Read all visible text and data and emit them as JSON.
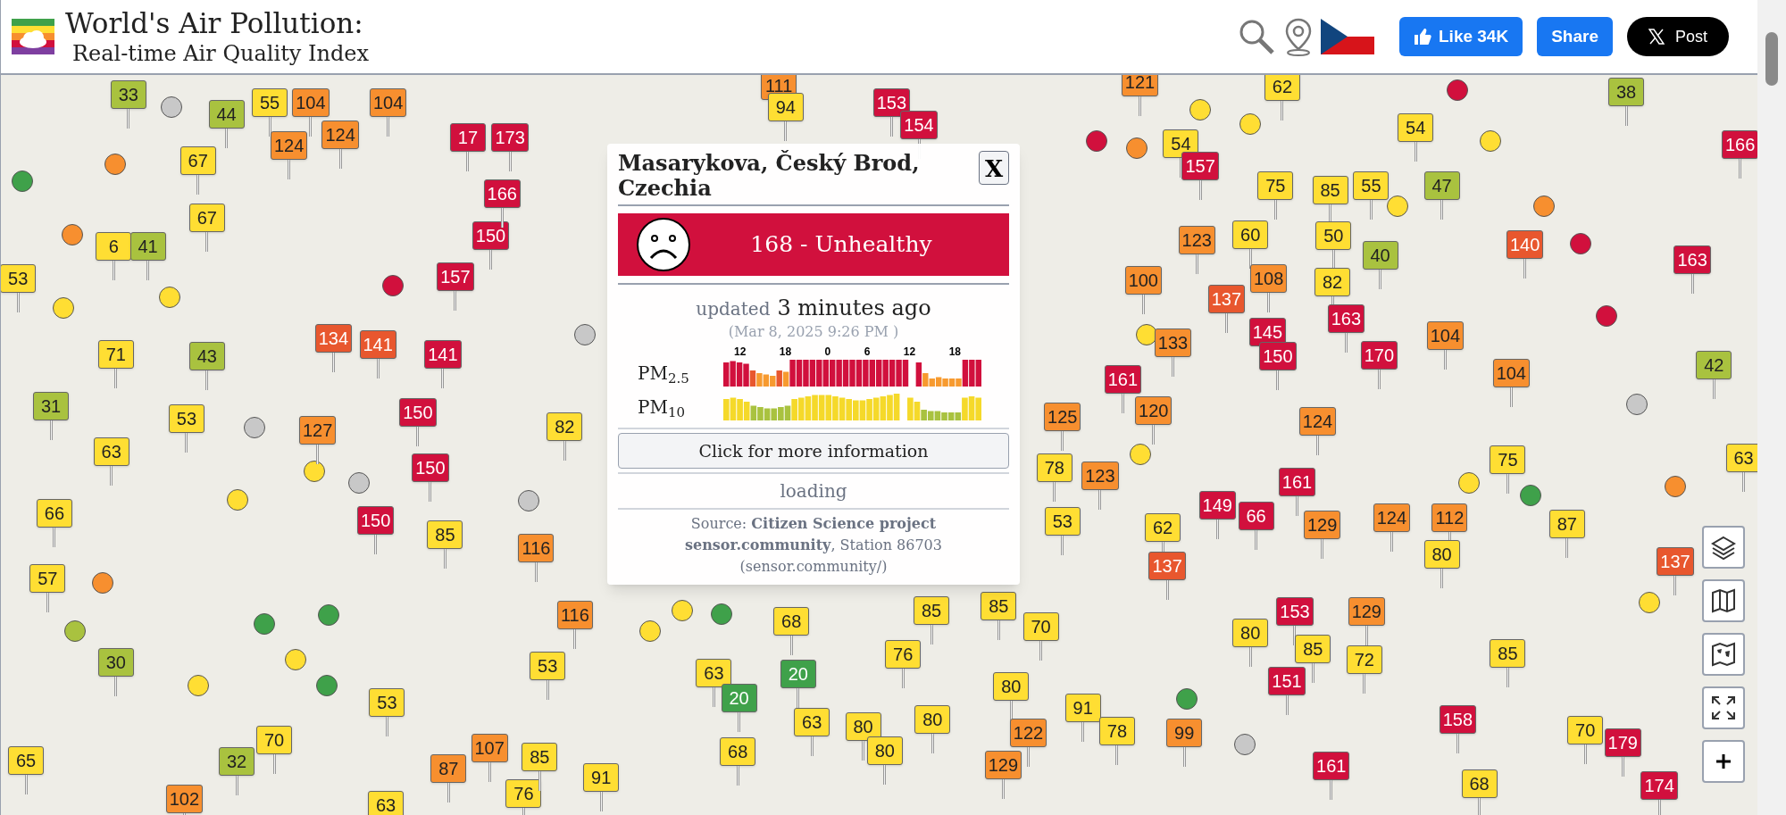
{
  "header": {
    "title": "World's Air Pollution:",
    "subtitle": "Real-time Air Quality Index",
    "like_button": "Like 34K",
    "share_button": "Share",
    "post_button": "Post"
  },
  "map": {
    "markers": [
      {
        "value": "33",
        "color": "#a9c23f"
      },
      {
        "value": "44",
        "color": "#a9c23f"
      },
      {
        "value": "55",
        "color": "#ffde33"
      },
      {
        "value": "104",
        "color": "#f78f2f"
      },
      {
        "value": "104",
        "color": "#f78f2f"
      },
      {
        "value": "111",
        "color": "#f78f2f"
      },
      {
        "value": "94",
        "color": "#ffde33"
      },
      {
        "value": "153",
        "color": "#d1103d"
      },
      {
        "value": "121",
        "color": "#f78f2f"
      },
      {
        "value": "62",
        "color": "#ffde33"
      },
      {
        "value": "38",
        "color": "#a9c23f"
      },
      {
        "value": "67",
        "color": "#ffde33"
      },
      {
        "value": "124",
        "color": "#f78f2f"
      },
      {
        "value": "124",
        "color": "#f78f2f"
      },
      {
        "value": "17",
        "color": "#d1103d"
      },
      {
        "value": "173",
        "color": "#d1103d"
      },
      {
        "value": "154",
        "color": "#d1103d"
      },
      {
        "value": "54",
        "color": "#ffde33"
      },
      {
        "value": "157",
        "color": "#d1103d"
      },
      {
        "value": "54",
        "color": "#ffde33"
      },
      {
        "value": "166",
        "color": "#d1103d"
      },
      {
        "value": "67",
        "color": "#ffde33"
      },
      {
        "value": "150",
        "color": "#d1103d"
      },
      {
        "value": "166",
        "color": "#d1103d"
      },
      {
        "value": "60",
        "color": "#ffde33"
      },
      {
        "value": "75",
        "color": "#ffde33"
      },
      {
        "value": "85",
        "color": "#ffde33"
      },
      {
        "value": "50",
        "color": "#ffde33"
      },
      {
        "value": "55",
        "color": "#ffde33"
      },
      {
        "value": "47",
        "color": "#a9c23f"
      },
      {
        "value": "53",
        "color": "#ffde33"
      },
      {
        "value": "6",
        "color": "#ffde33"
      },
      {
        "value": "41",
        "color": "#a9c23f"
      },
      {
        "value": "157",
        "color": "#d1103d"
      },
      {
        "value": "100",
        "color": "#f78f2f"
      },
      {
        "value": "123",
        "color": "#f78f2f"
      },
      {
        "value": "108",
        "color": "#f78f2f"
      },
      {
        "value": "82",
        "color": "#ffde33"
      },
      {
        "value": "40",
        "color": "#a9c23f"
      },
      {
        "value": "140",
        "color": "#e8572e"
      },
      {
        "value": "163",
        "color": "#d1103d"
      },
      {
        "value": "134",
        "color": "#e8572e"
      },
      {
        "value": "141",
        "color": "#e8572e"
      },
      {
        "value": "133",
        "color": "#f78f2f"
      },
      {
        "value": "137",
        "color": "#e8572e"
      },
      {
        "value": "145",
        "color": "#d1103d"
      },
      {
        "value": "163",
        "color": "#d1103d"
      },
      {
        "value": "104",
        "color": "#f78f2f"
      },
      {
        "value": "31",
        "color": "#a9c23f"
      },
      {
        "value": "71",
        "color": "#ffde33"
      },
      {
        "value": "43",
        "color": "#a9c23f"
      },
      {
        "value": "141",
        "color": "#d1103d"
      },
      {
        "value": "161",
        "color": "#d1103d"
      },
      {
        "value": "150",
        "color": "#d1103d"
      },
      {
        "value": "170",
        "color": "#d1103d"
      },
      {
        "value": "104",
        "color": "#f78f2f"
      },
      {
        "value": "42",
        "color": "#a9c23f"
      },
      {
        "value": "63",
        "color": "#ffde33"
      },
      {
        "value": "53",
        "color": "#ffde33"
      },
      {
        "value": "127",
        "color": "#f78f2f"
      },
      {
        "value": "150",
        "color": "#d1103d"
      },
      {
        "value": "82",
        "color": "#ffde33"
      },
      {
        "value": "125",
        "color": "#f78f2f"
      },
      {
        "value": "120",
        "color": "#f78f2f"
      },
      {
        "value": "124",
        "color": "#f78f2f"
      },
      {
        "value": "75",
        "color": "#ffde33"
      },
      {
        "value": "63",
        "color": "#ffde33"
      },
      {
        "value": "66",
        "color": "#ffde33"
      },
      {
        "value": "150",
        "color": "#d1103d"
      },
      {
        "value": "150",
        "color": "#d1103d"
      },
      {
        "value": "78",
        "color": "#ffde33"
      },
      {
        "value": "53",
        "color": "#ffde33"
      },
      {
        "value": "123",
        "color": "#f78f2f"
      },
      {
        "value": "149",
        "color": "#d1103d"
      },
      {
        "value": "66",
        "color": "#d1103d"
      },
      {
        "value": "161",
        "color": "#d1103d"
      },
      {
        "value": "124",
        "color": "#f78f2f"
      },
      {
        "value": "112",
        "color": "#f78f2f"
      },
      {
        "value": "57",
        "color": "#ffde33"
      },
      {
        "value": "85",
        "color": "#ffde33"
      },
      {
        "value": "116",
        "color": "#f78f2f"
      },
      {
        "value": "62",
        "color": "#ffde33"
      },
      {
        "value": "137",
        "color": "#e8572e"
      },
      {
        "value": "129",
        "color": "#f78f2f"
      },
      {
        "value": "80",
        "color": "#ffde33"
      },
      {
        "value": "87",
        "color": "#ffde33"
      },
      {
        "value": "137",
        "color": "#e8572e"
      },
      {
        "value": "116",
        "color": "#f78f2f"
      },
      {
        "value": "68",
        "color": "#ffde33"
      },
      {
        "value": "85",
        "color": "#ffde33"
      },
      {
        "value": "85",
        "color": "#ffde33"
      },
      {
        "value": "70",
        "color": "#ffde33"
      },
      {
        "value": "80",
        "color": "#ffde33"
      },
      {
        "value": "153",
        "color": "#d1103d"
      },
      {
        "value": "129",
        "color": "#f78f2f"
      },
      {
        "value": "30",
        "color": "#a9c23f"
      },
      {
        "value": "53",
        "color": "#ffde33"
      },
      {
        "value": "63",
        "color": "#ffde33"
      },
      {
        "value": "20",
        "color": "#3fa14a"
      },
      {
        "value": "76",
        "color": "#ffde33"
      },
      {
        "value": "80",
        "color": "#ffde33"
      },
      {
        "value": "151",
        "color": "#d1103d"
      },
      {
        "value": "85",
        "color": "#ffde33"
      },
      {
        "value": "72",
        "color": "#ffde33"
      },
      {
        "value": "85",
        "color": "#ffde33"
      },
      {
        "value": "65",
        "color": "#ffde33"
      },
      {
        "value": "70",
        "color": "#ffde33"
      },
      {
        "value": "53",
        "color": "#ffde33"
      },
      {
        "value": "107",
        "color": "#f78f2f"
      },
      {
        "value": "20",
        "color": "#3fa14a"
      },
      {
        "value": "63",
        "color": "#ffde33"
      },
      {
        "value": "80",
        "color": "#ffde33"
      },
      {
        "value": "80",
        "color": "#ffde33"
      },
      {
        "value": "122",
        "color": "#f78f2f"
      },
      {
        "value": "91",
        "color": "#ffde33"
      },
      {
        "value": "78",
        "color": "#ffde33"
      },
      {
        "value": "99",
        "color": "#f78f2f"
      },
      {
        "value": "158",
        "color": "#d1103d"
      },
      {
        "value": "70",
        "color": "#ffde33"
      },
      {
        "value": "179",
        "color": "#d1103d"
      },
      {
        "value": "102",
        "color": "#f78f2f"
      },
      {
        "value": "32",
        "color": "#a9c23f"
      },
      {
        "value": "63",
        "color": "#ffde33"
      },
      {
        "value": "87",
        "color": "#f78f2f"
      },
      {
        "value": "76",
        "color": "#ffde33"
      },
      {
        "value": "85",
        "color": "#ffde33"
      },
      {
        "value": "91",
        "color": "#ffde33"
      },
      {
        "value": "68",
        "color": "#ffde33"
      },
      {
        "value": "80",
        "color": "#ffde33"
      },
      {
        "value": "129",
        "color": "#f78f2f"
      },
      {
        "value": "161",
        "color": "#d1103d"
      },
      {
        "value": "68",
        "color": "#ffde33"
      },
      {
        "value": "174",
        "color": "#d1103d"
      }
    ],
    "dots": [
      {
        "color": "#3fa14a"
      },
      {
        "color": "#f78f2f"
      },
      {
        "color": "#f78f2f"
      },
      {
        "color": "#c8c8c8"
      },
      {
        "color": "#ffde33"
      },
      {
        "color": "#ffde33"
      },
      {
        "color": "#d1103d"
      },
      {
        "color": "#c8c8c8"
      },
      {
        "color": "#c8c8c8"
      },
      {
        "color": "#ffde33"
      },
      {
        "color": "#ffde33"
      },
      {
        "color": "#c8c8c8"
      },
      {
        "color": "#c8c8c8"
      },
      {
        "color": "#f78f2f"
      },
      {
        "color": "#a9c23f"
      },
      {
        "color": "#3fa14a"
      },
      {
        "color": "#3fa14a"
      },
      {
        "color": "#3fa14a"
      },
      {
        "color": "#ffde33"
      },
      {
        "color": "#ffde33"
      },
      {
        "color": "#ffde33"
      },
      {
        "color": "#3fa14a"
      },
      {
        "color": "#ffde33"
      },
      {
        "color": "#ffde33"
      },
      {
        "color": "#c8c8c8"
      },
      {
        "color": "#d1103d"
      },
      {
        "color": "#d1103d"
      },
      {
        "color": "#f78f2f"
      },
      {
        "color": "#ffde33"
      },
      {
        "color": "#d1103d"
      },
      {
        "color": "#ffde33"
      },
      {
        "color": "#ffde33"
      },
      {
        "color": "#d1103d"
      },
      {
        "color": "#f78f2f"
      },
      {
        "color": "#ffde33"
      },
      {
        "color": "#ffde33"
      },
      {
        "color": "#3fa14a"
      },
      {
        "color": "#ffde33"
      },
      {
        "color": "#3fa14a"
      },
      {
        "color": "#c8c8c8"
      },
      {
        "color": "#f78f2f"
      },
      {
        "color": "#ffde33"
      }
    ]
  },
  "popup": {
    "title": "Masarykova, Český Brod, Czechia",
    "close": "X",
    "aqi": {
      "text": "168 - Unhealthy",
      "color": "#d1103d"
    },
    "updated_label": "updated",
    "updated_time": "3 minutes ago",
    "timestamp": "(Mar 8, 2025 9:26 PM )",
    "hour_labels": [
      "12",
      "18",
      "0",
      "6",
      "12",
      "18"
    ],
    "pm25_label": "PM$_{2.5}$",
    "pm10_label": "PM$_{10}$",
    "more_button": "Click for more information",
    "loading": "loading",
    "source": "Source: **Citizen Science project sensor.community**, Station 86703 (sensor.community/)"
  }
}
